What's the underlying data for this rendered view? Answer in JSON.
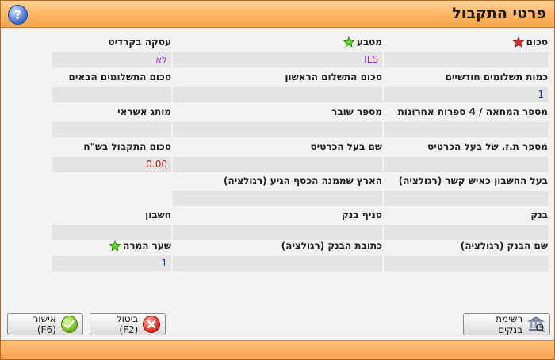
{
  "window": {
    "title": "פרטי התקבול",
    "help_label": "?"
  },
  "fields": {
    "sum": {
      "label": "סכום",
      "value": ""
    },
    "currency": {
      "label": "מטבע",
      "value": "ILS"
    },
    "credit_deal": {
      "label": "עסקה בקרדיט",
      "value": "לא"
    },
    "monthly_payments": {
      "label": "כמות תשלומים חודשיים",
      "value": "1"
    },
    "first_payment": {
      "label": "סכום התשלום הראשון",
      "value": ""
    },
    "next_payments": {
      "label": "סכום התשלומים הבאים",
      "value": ""
    },
    "card_number": {
      "label": "מספר המחאה / 4 ספרות אחרונות",
      "value": ""
    },
    "voucher": {
      "label": "מספר שובר",
      "value": ""
    },
    "credit_brand": {
      "label": "מותג אשראי",
      "value": ""
    },
    "holder_id": {
      "label": "מספר ת.ז. של בעל הכרטיס",
      "value": ""
    },
    "holder_name": {
      "label": "שם בעל הכרטיס",
      "value": ""
    },
    "sum_nis": {
      "label": "סכום התקבול בש\"ח",
      "value": "0.00"
    },
    "account_holder": {
      "label": "בעל החשבון כאיש קשר (רגולציה)",
      "value": ""
    },
    "origin_country": {
      "label": "הארץ שממנה הכסף הגיע (רגולציה)",
      "value": ""
    },
    "bank": {
      "label": "בנק",
      "value": ""
    },
    "branch": {
      "label": "סניף בנק",
      "value": ""
    },
    "account": {
      "label": "חשבון",
      "value": ""
    },
    "bank_name": {
      "label": "שם הבנק (רגולציה)",
      "value": ""
    },
    "bank_address": {
      "label": "כתובת הבנק (רגולציה)",
      "value": ""
    },
    "exchange_rate": {
      "label": "שער המרה",
      "value": "1"
    }
  },
  "buttons": {
    "banks_list": "רשימת בנקים",
    "cancel": "ביטול (F2)",
    "confirm": "אישור (F6)"
  },
  "colors": {
    "value_text": "#2233aa",
    "purple_text": "#9a2bd6",
    "red_text": "#c21a1a"
  },
  "icons": {
    "required": "red-star-icon",
    "info": "green-star-icon"
  }
}
